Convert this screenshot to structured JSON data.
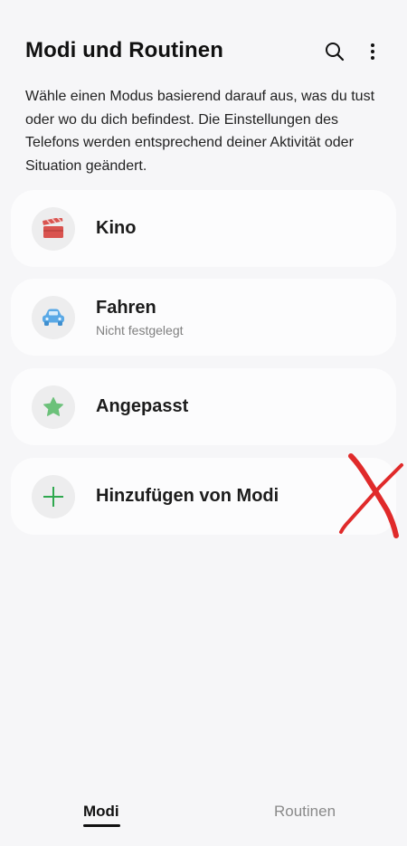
{
  "header": {
    "title": "Modi und Routinen",
    "search_icon": "search-icon",
    "more_icon": "more-vertical-icon"
  },
  "description": "Wähle einen Modus basierend darauf aus, was du tust oder wo du dich befindest. Die Einstellungen des Telefons werden entsprechend deiner Aktivität oder Situation geändert.",
  "modes": [
    {
      "label": "Kino",
      "subtitle": "",
      "icon": "clapperboard-icon",
      "icon_color": "#d9534f"
    },
    {
      "label": "Fahren",
      "subtitle": "Nicht festgelegt",
      "icon": "car-icon",
      "icon_color": "#5aa9e6"
    },
    {
      "label": "Angepasst",
      "subtitle": "",
      "icon": "star-icon",
      "icon_color": "#6cc17a"
    },
    {
      "label": "Hinzufügen von Modi",
      "subtitle": "",
      "icon": "plus-icon",
      "icon_color": "#2fa84f"
    }
  ],
  "annotation": {
    "color": "#e02a2a"
  },
  "bottom_nav": {
    "tabs": [
      {
        "label": "Modi",
        "active": true
      },
      {
        "label": "Routinen",
        "active": false
      }
    ]
  }
}
